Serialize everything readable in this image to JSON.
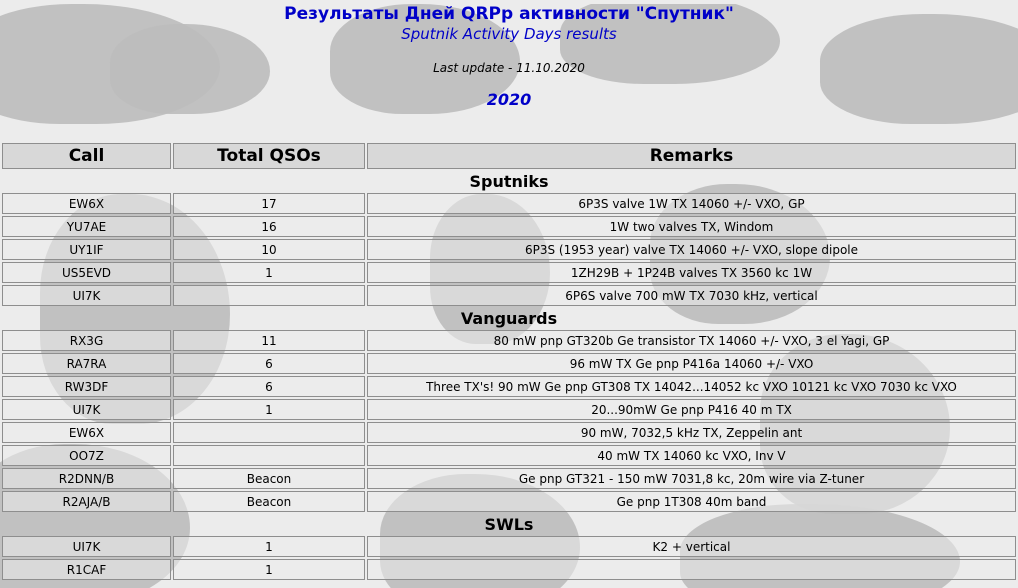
{
  "header": {
    "title_ru": "Результаты Дней QRPp активности \"Спутник\"",
    "title_en": "Sputnik Activity Days results",
    "last_update": "Last update - 11.10.2020",
    "year": "2020"
  },
  "table": {
    "columns": [
      "Call",
      "Total QSOs",
      "Remarks"
    ],
    "sections": [
      {
        "title": "Sputniks",
        "rows": [
          {
            "call": "EW6X",
            "qsos": "17",
            "remarks": "6P3S valve 1W TX 14060 +/- VXO, GP"
          },
          {
            "call": "YU7AE",
            "qsos": "16",
            "remarks": "1W two valves TX, Windom"
          },
          {
            "call": "UY1IF",
            "qsos": "10",
            "remarks": "6P3S (1953 year) valve TX 14060 +/- VXO, slope dipole"
          },
          {
            "call": "US5EVD",
            "qsos": "1",
            "remarks": "1ZH29B + 1P24B valves TX 3560 kc 1W"
          },
          {
            "call": "UI7K",
            "qsos": "",
            "remarks": "6P6S valve 700 mW TX 7030 kHz, vertical"
          }
        ]
      },
      {
        "title": "Vanguards",
        "rows": [
          {
            "call": "RX3G",
            "qsos": "11",
            "remarks": "80 mW pnp GT320b Ge transistor TX 14060 +/- VXO, 3 el Yagi, GP"
          },
          {
            "call": "RA7RA",
            "qsos": "6",
            "remarks": "96 mW TX Ge pnp P416a 14060 +/- VXO"
          },
          {
            "call": "RW3DF",
            "qsos": "6",
            "remarks": "Three TX's! 90 mW Ge pnp GT308 TX 14042...14052 kc VXO 10121 kc VXO 7030 kc VXO"
          },
          {
            "call": "UI7K",
            "qsos": "1",
            "remarks": "20...90mW Ge pnp P416 40 m TX"
          },
          {
            "call": "EW6X",
            "qsos": "",
            "remarks": "90 mW, 7032,5 kHz TX, Zeppelin ant"
          },
          {
            "call": "OO7Z",
            "qsos": "",
            "remarks": "40 mW TX 14060 kc VXO, Inv V"
          },
          {
            "call": "R2DNN/B",
            "qsos": "Beacon",
            "remarks": "Ge pnp GT321 - 150 mW 7031,8 kc, 20m wire via Z-tuner"
          },
          {
            "call": "R2AJA/B",
            "qsos": "Beacon",
            "remarks": "Ge pnp 1T308 40m band"
          }
        ]
      },
      {
        "title": "SWLs",
        "rows": [
          {
            "call": "UI7K",
            "qsos": "1",
            "remarks": "K2 + vertical"
          },
          {
            "call": "R1CAF",
            "qsos": "1",
            "remarks": ""
          }
        ]
      }
    ]
  }
}
